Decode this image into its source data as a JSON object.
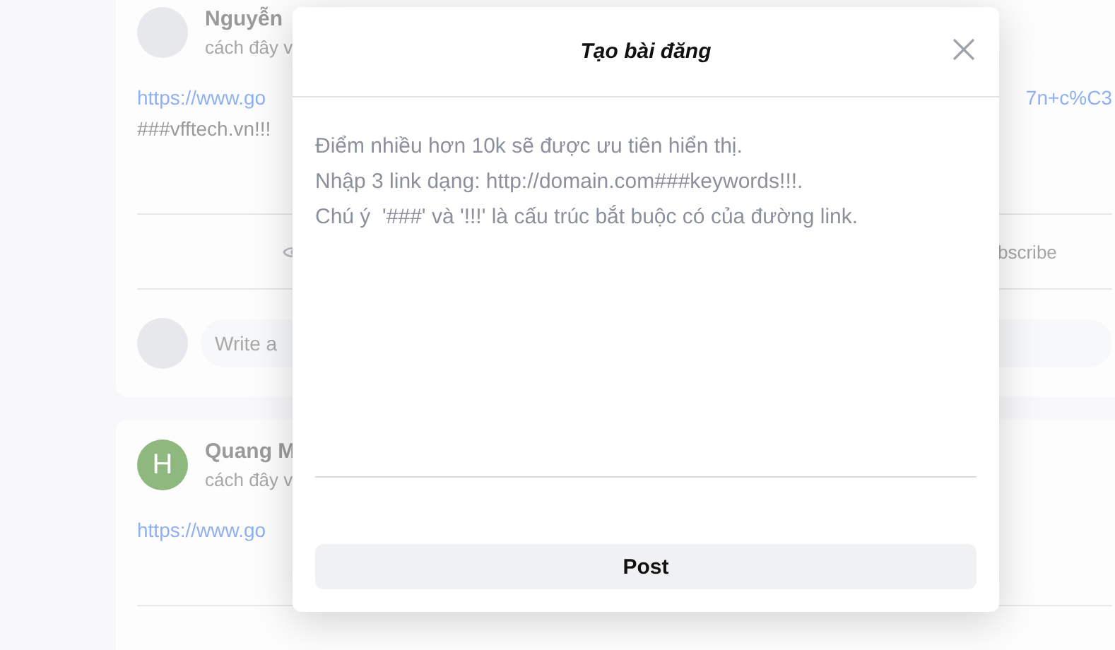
{
  "feed": [
    {
      "kind": "photo",
      "name": "Nguyễn",
      "time": "cách đây v",
      "link_start": "https://www.go",
      "link_end": "7n+c%C3",
      "keywords": "###vfftech.vn!!!",
      "action": "bscribe",
      "comment_placeholder": "Write a"
    },
    {
      "kind": "letter",
      "letter": "H",
      "color": "#8fb87e",
      "name": "Quang M",
      "time": "cách đây v",
      "link_start": "https://www.go"
    }
  ],
  "modal": {
    "title": "Tạo bài đăng",
    "placeholder": "Điểm nhiều hơn 10k sẽ được ưu tiên hiển thị.\nNhập 3 link dạng: http://domain.com###keywords!!!.\nChú ý  '###' và '!!!' là cấu trúc bắt buộc có của đường link.",
    "button": "Post"
  }
}
